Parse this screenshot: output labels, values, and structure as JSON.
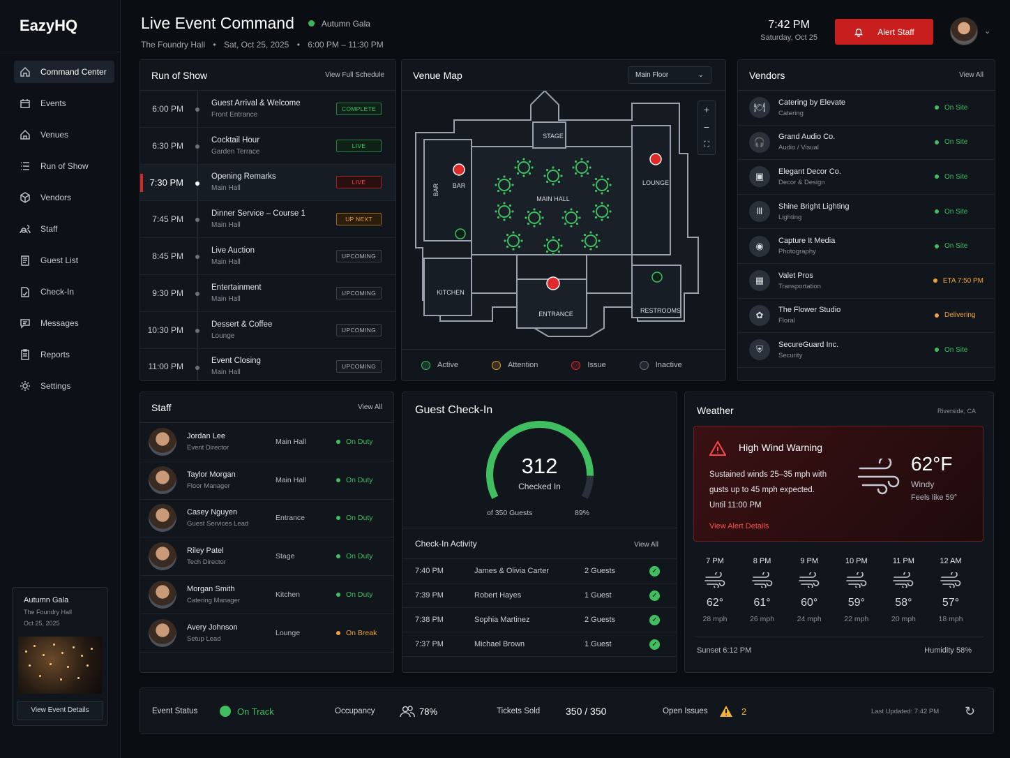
{
  "app": {
    "name": "EazyHQ"
  },
  "nav": [
    {
      "label": "Command Center",
      "icon": "home-icon"
    },
    {
      "label": "Events",
      "icon": "calendar-icon"
    },
    {
      "label": "Venues",
      "icon": "building-icon"
    },
    {
      "label": "Run of Show",
      "icon": "list-icon"
    },
    {
      "label": "Vendors",
      "icon": "box-icon"
    },
    {
      "label": "Staff",
      "icon": "users-icon"
    },
    {
      "label": "Guest List",
      "icon": "clipboard-icon"
    },
    {
      "label": "Check-In",
      "icon": "checkin-icon"
    },
    {
      "label": "Messages",
      "icon": "message-icon"
    },
    {
      "label": "Reports",
      "icon": "report-icon"
    },
    {
      "label": "Settings",
      "icon": "gear-icon"
    }
  ],
  "event_card": {
    "title": "Autumn Gala",
    "venue": "The Foundry Hall",
    "date": "Oct 25, 2025",
    "button": "View Event Details"
  },
  "header": {
    "title": "Live Event Command",
    "event": "Autumn Gala",
    "venue": "The Foundry Hall",
    "date": "Sat, Oct 25, 2025",
    "time_range": "6:00 PM – 11:30 PM",
    "sep": "•",
    "clock": "7:42 PM",
    "clock_date": "Saturday, Oct 25",
    "alert_button": "Alert Staff"
  },
  "run_of_show": {
    "title": "Run of Show",
    "link": "View Full Schedule",
    "items": [
      {
        "time": "6:00 PM",
        "name": "Guest Arrival & Welcome",
        "location": "Front Entrance",
        "status": "COMPLETE"
      },
      {
        "time": "6:30 PM",
        "name": "Cocktail Hour",
        "location": "Garden Terrace",
        "status": "LIVE"
      },
      {
        "time": "7:30 PM",
        "name": "Opening Remarks",
        "location": "Main Hall",
        "status": "LIVE"
      },
      {
        "time": "7:45 PM",
        "name": "Dinner Service – Course 1",
        "location": "Main Hall",
        "status": "UP NEXT"
      },
      {
        "time": "8:45 PM",
        "name": "Live Auction",
        "location": "Main Hall",
        "status": "UPCOMING"
      },
      {
        "time": "9:30 PM",
        "name": "Entertainment",
        "location": "Main Hall",
        "status": "UPCOMING"
      },
      {
        "time": "10:30 PM",
        "name": "Dessert & Coffee",
        "location": "Lounge",
        "status": "UPCOMING"
      },
      {
        "time": "11:00 PM",
        "name": "Event Closing",
        "location": "Main Hall",
        "status": "UPCOMING"
      }
    ]
  },
  "venue_map": {
    "title": "Venue Map",
    "floor": "Main Floor",
    "rooms": {
      "stage": "STAGE",
      "bar": "BAR",
      "main_hall": "MAIN HALL",
      "lounge": "LOUNGE",
      "kitchen": "KITCHEN",
      "entrance": "ENTRANCE",
      "restrooms": "RESTROOMS"
    },
    "legend": [
      {
        "label": "Active",
        "color": "#3fbf5f"
      },
      {
        "label": "Attention",
        "color": "#e89a2e"
      },
      {
        "label": "Issue",
        "color": "#e02a2a"
      },
      {
        "label": "Inactive",
        "color": "#6b727c"
      }
    ],
    "zoom_in": "+",
    "zoom_out": "−",
    "fit": "⛶"
  },
  "vendors": {
    "title": "Vendors",
    "link": "View All",
    "items": [
      {
        "name": "Catering by Elevate",
        "category": "Catering",
        "status": "On Site",
        "color": "#3fbf5f",
        "icon": "🍽"
      },
      {
        "name": "Grand Audio Co.",
        "category": "Audio / Visual",
        "status": "On Site",
        "color": "#3fbf5f",
        "icon": "🎧"
      },
      {
        "name": "Elegant Decor Co.",
        "category": "Decor & Design",
        "status": "On Site",
        "color": "#3fbf5f",
        "icon": "▣"
      },
      {
        "name": "Shine Bright Lighting",
        "category": "Lighting",
        "status": "On Site",
        "color": "#3fbf5f",
        "icon": "Ⅲ"
      },
      {
        "name": "Capture It Media",
        "category": "Photography",
        "status": "On Site",
        "color": "#3fbf5f",
        "icon": "◉"
      },
      {
        "name": "Valet Pros",
        "category": "Transportation",
        "status": "ETA 7:50 PM",
        "color": "#f2a33a",
        "icon": "▦"
      },
      {
        "name": "The Flower Studio",
        "category": "Floral",
        "status": "Delivering",
        "color": "#f2a33a",
        "icon": "✿"
      },
      {
        "name": "SecureGuard Inc.",
        "category": "Security",
        "status": "On Site",
        "color": "#3fbf5f",
        "icon": "⛨"
      }
    ]
  },
  "staff": {
    "title": "Staff",
    "link": "View All",
    "items": [
      {
        "name": "Jordan Lee",
        "role": "Event Director",
        "location": "Main Hall",
        "status": "On Duty",
        "color": "#3fbf5f"
      },
      {
        "name": "Taylor Morgan",
        "role": "Floor Manager",
        "location": "Main Hall",
        "status": "On Duty",
        "color": "#3fbf5f"
      },
      {
        "name": "Casey Nguyen",
        "role": "Guest Services Lead",
        "location": "Entrance",
        "status": "On Duty",
        "color": "#3fbf5f"
      },
      {
        "name": "Riley Patel",
        "role": "Tech Director",
        "location": "Stage",
        "status": "On Duty",
        "color": "#3fbf5f"
      },
      {
        "name": "Morgan Smith",
        "role": "Catering Manager",
        "location": "Kitchen",
        "status": "On Duty",
        "color": "#3fbf5f"
      },
      {
        "name": "Avery Johnson",
        "role": "Setup Lead",
        "location": "Lounge",
        "status": "On Break",
        "color": "#f2a33a"
      }
    ]
  },
  "checkin": {
    "title": "Guest Check-In",
    "count": "312",
    "count_label": "Checked In",
    "total": "of 350 Guests",
    "percent": "89%",
    "fraction": 0.89,
    "activity_title": "Check-In Activity",
    "activity_link": "View All",
    "activity": [
      {
        "time": "7:40 PM",
        "name": "James & Olivia Carter",
        "guests": "2 Guests"
      },
      {
        "time": "7:39 PM",
        "name": "Robert Hayes",
        "guests": "1 Guest"
      },
      {
        "time": "7:38 PM",
        "name": "Sophia Martinez",
        "guests": "2 Guests"
      },
      {
        "time": "7:37 PM",
        "name": "Michael Brown",
        "guests": "1 Guest"
      }
    ]
  },
  "weather": {
    "title": "Weather",
    "location": "Riverside, CA",
    "alert_title": "High Wind Warning",
    "alert_line1": "Sustained winds 25–35 mph with",
    "alert_line2": "gusts up to 45 mph expected.",
    "alert_until": "Until 11:00 PM",
    "alert_link": "View Alert Details",
    "temp": "62°F",
    "condition": "Windy",
    "feels": "Feels like 59°",
    "hours": [
      {
        "hour": "7 PM",
        "temp": "62°",
        "wind": "28 mph"
      },
      {
        "hour": "8 PM",
        "temp": "61°",
        "wind": "26 mph"
      },
      {
        "hour": "9 PM",
        "temp": "60°",
        "wind": "24 mph"
      },
      {
        "hour": "10 PM",
        "temp": "59°",
        "wind": "22 mph"
      },
      {
        "hour": "11 PM",
        "temp": "58°",
        "wind": "20 mph"
      },
      {
        "hour": "12 AM",
        "temp": "57°",
        "wind": "18 mph"
      }
    ],
    "sunset": "Sunset 6:12 PM",
    "humidity": "Humidity 58%"
  },
  "status_bar": {
    "event_status_label": "Event Status",
    "event_status": "On Track",
    "occupancy_label": "Occupancy",
    "occupancy": "78%",
    "tickets_label": "Tickets Sold",
    "tickets": "350 / 350",
    "issues_label": "Open Issues",
    "issues": "2",
    "updated": "Last Updated:  7:42 PM"
  }
}
